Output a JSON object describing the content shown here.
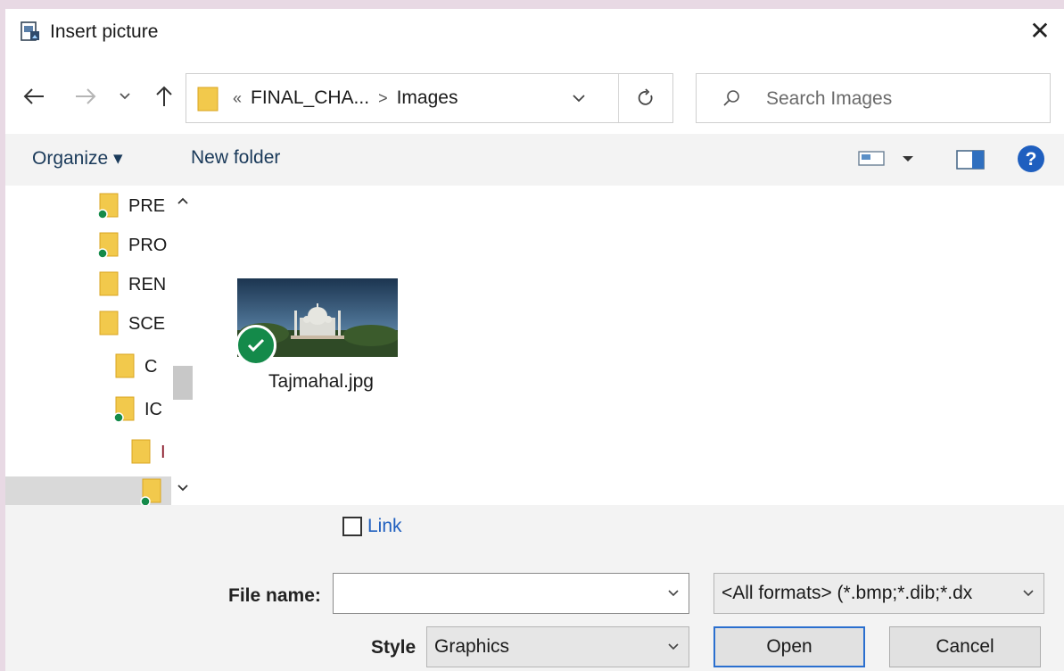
{
  "dialog": {
    "title": "Insert picture",
    "close_glyph": "✕",
    "title_icon": "insert-picture-icon"
  },
  "nav": {
    "back_icon": "back-arrow-icon",
    "forward_icon": "forward-arrow-icon",
    "recent_icon": "chevron-down-icon",
    "up_icon": "up-arrow-icon",
    "address": {
      "overflow": "«",
      "parent": "FINAL_CHA...",
      "separator": ">",
      "current": "Images"
    },
    "refresh_icon": "refresh-icon",
    "search_placeholder": "Search Images"
  },
  "toolbar": {
    "organize_label": "Organize ▾",
    "new_folder_label": "New folder",
    "view_icon": "view-options-icon",
    "preview_icon": "preview-pane-icon",
    "help_icon": "help-icon"
  },
  "tree": {
    "items": [
      {
        "label": "PRE",
        "synced": true
      },
      {
        "label": "PRO",
        "synced": true
      },
      {
        "label": "REN",
        "synced": false
      },
      {
        "label": "SCE",
        "synced": false
      },
      {
        "label": "C",
        "synced": false
      },
      {
        "label": "IC",
        "synced": true
      },
      {
        "label": "I",
        "synced": false
      },
      {
        "label": "",
        "synced": true,
        "selected": true
      }
    ]
  },
  "files": [
    {
      "name": "Tajmahal.jpg",
      "status": "synced-check-icon"
    }
  ],
  "bottom": {
    "link_label": "Link",
    "link_checked": false,
    "file_name_label": "File name:",
    "file_name_value": "",
    "format_value": "<All formats> (*.bmp;*.dib;*.dx",
    "style_label": "Style",
    "style_value": "Graphics",
    "open_label": "Open",
    "cancel_label": "Cancel"
  },
  "colors": {
    "accent": "#2a6fcf",
    "sync_green": "#148a4a",
    "folder_yellow": "#f2c94c",
    "help_blue": "#1f5fbf"
  }
}
